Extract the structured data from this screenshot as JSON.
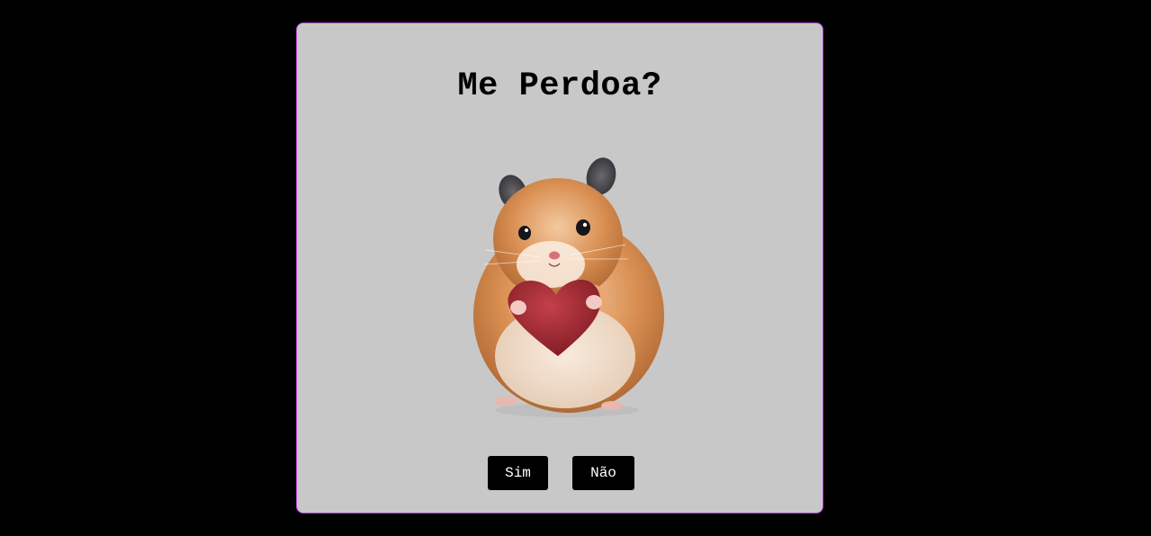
{
  "card": {
    "title": "Me Perdoa?",
    "image_subject": "hamster-holding-heart-image",
    "buttons": {
      "yes_label": "Sim",
      "no_label": "Não"
    }
  },
  "colors": {
    "page_background": "#000000",
    "card_background": "#c8c8c8",
    "card_border": "#b04bd0",
    "button_background": "#000000",
    "button_text": "#ffffff",
    "heart": "#a8232e"
  }
}
